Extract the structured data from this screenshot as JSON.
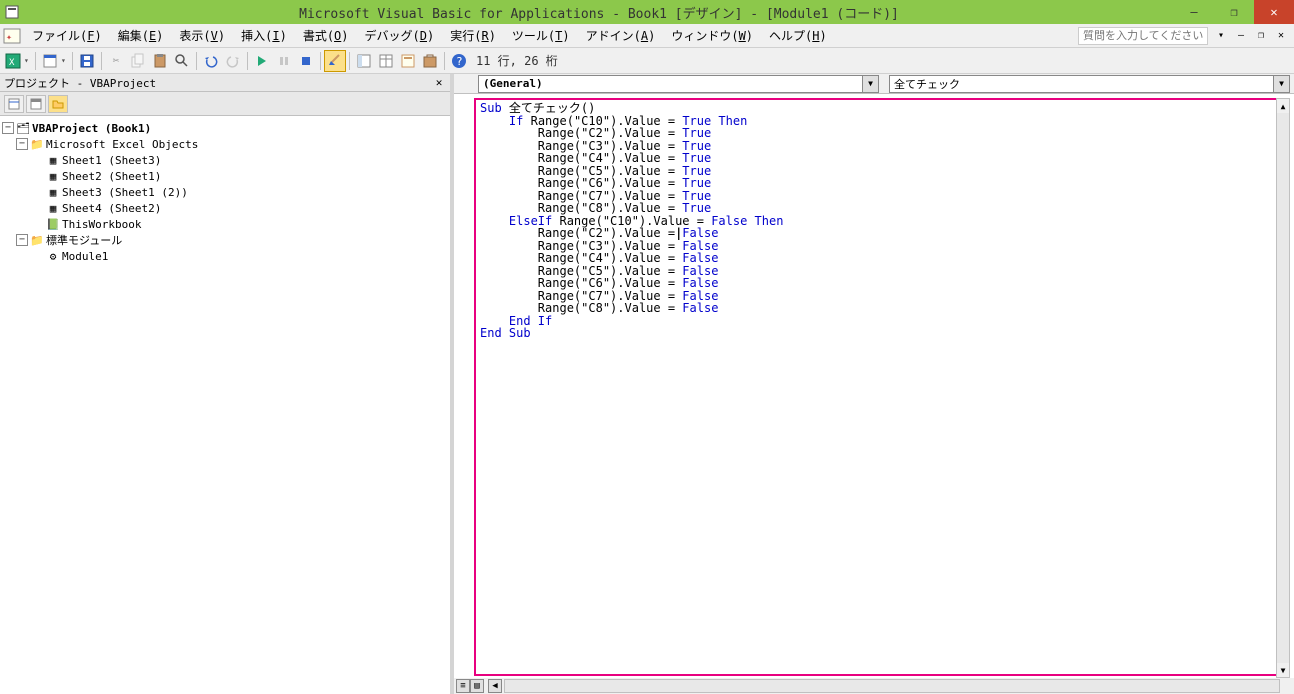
{
  "title": "Microsoft Visual Basic for Applications - Book1 [デザイン] - [Module1 (コード)]",
  "menus": {
    "file": {
      "label": "ファイル(",
      "key": "F",
      "suffix": ")"
    },
    "edit": {
      "label": "編集(",
      "key": "E",
      "suffix": ")"
    },
    "view": {
      "label": "表示(",
      "key": "V",
      "suffix": ")"
    },
    "insert": {
      "label": "挿入(",
      "key": "I",
      "suffix": ")"
    },
    "format": {
      "label": "書式(",
      "key": "O",
      "suffix": ")"
    },
    "debug": {
      "label": "デバッグ(",
      "key": "D",
      "suffix": ")"
    },
    "run": {
      "label": "実行(",
      "key": "R",
      "suffix": ")"
    },
    "tools": {
      "label": "ツール(",
      "key": "T",
      "suffix": ")"
    },
    "addin": {
      "label": "アドイン(",
      "key": "A",
      "suffix": ")"
    },
    "window": {
      "label": "ウィンドウ(",
      "key": "W",
      "suffix": ")"
    },
    "help": {
      "label": "ヘルプ(",
      "key": "H",
      "suffix": ")"
    }
  },
  "help_placeholder": "質問を入力してください",
  "toolbar": {
    "cursor_info": "11 行, 26 桁"
  },
  "project_panel": {
    "title": "プロジェクト - VBAProject",
    "root": "VBAProject (Book1)",
    "objects_folder": "Microsoft Excel Objects",
    "modules_folder": "標準モジュール",
    "sheets": [
      "Sheet1 (Sheet3)",
      "Sheet2 (Sheet1)",
      "Sheet3 (Sheet1 (2))",
      "Sheet4 (Sheet2)"
    ],
    "thisworkbook": "ThisWorkbook",
    "module": "Module1"
  },
  "code_dropdowns": {
    "object": "(General)",
    "procedure": "全てチェック"
  },
  "code_lines": [
    {
      "indent": 0,
      "tokens": [
        {
          "t": "Sub ",
          "k": true
        },
        {
          "t": "全てチェック()"
        }
      ]
    },
    {
      "indent": 1,
      "tokens": [
        {
          "t": "If ",
          "k": true
        },
        {
          "t": "Range(\"C10\").Value = "
        },
        {
          "t": "True Then",
          "k": true
        }
      ]
    },
    {
      "indent": 2,
      "tokens": [
        {
          "t": "Range(\"C2\").Value = "
        },
        {
          "t": "True",
          "k": true
        }
      ]
    },
    {
      "indent": 2,
      "tokens": [
        {
          "t": "Range(\"C3\").Value = "
        },
        {
          "t": "True",
          "k": true
        }
      ]
    },
    {
      "indent": 2,
      "tokens": [
        {
          "t": "Range(\"C4\").Value = "
        },
        {
          "t": "True",
          "k": true
        }
      ]
    },
    {
      "indent": 2,
      "tokens": [
        {
          "t": "Range(\"C5\").Value = "
        },
        {
          "t": "True",
          "k": true
        }
      ]
    },
    {
      "indent": 2,
      "tokens": [
        {
          "t": "Range(\"C6\").Value = "
        },
        {
          "t": "True",
          "k": true
        }
      ]
    },
    {
      "indent": 2,
      "tokens": [
        {
          "t": "Range(\"C7\").Value = "
        },
        {
          "t": "True",
          "k": true
        }
      ]
    },
    {
      "indent": 2,
      "tokens": [
        {
          "t": "Range(\"C8\").Value = "
        },
        {
          "t": "True",
          "k": true
        }
      ]
    },
    {
      "indent": 1,
      "tokens": [
        {
          "t": "ElseIf ",
          "k": true
        },
        {
          "t": "Range(\"C10\").Value = "
        },
        {
          "t": "False Then",
          "k": true
        }
      ]
    },
    {
      "indent": 2,
      "tokens": [
        {
          "t": "Range(\"C2\").Value ="
        },
        {
          "t": "|",
          "cursor": true
        },
        {
          "t": " False",
          "k": true
        }
      ]
    },
    {
      "indent": 2,
      "tokens": [
        {
          "t": "Range(\"C3\").Value = "
        },
        {
          "t": "False",
          "k": true
        }
      ]
    },
    {
      "indent": 2,
      "tokens": [
        {
          "t": "Range(\"C4\").Value = "
        },
        {
          "t": "False",
          "k": true
        }
      ]
    },
    {
      "indent": 2,
      "tokens": [
        {
          "t": "Range(\"C5\").Value = "
        },
        {
          "t": "False",
          "k": true
        }
      ]
    },
    {
      "indent": 2,
      "tokens": [
        {
          "t": "Range(\"C6\").Value = "
        },
        {
          "t": "False",
          "k": true
        }
      ]
    },
    {
      "indent": 2,
      "tokens": [
        {
          "t": "Range(\"C7\").Value = "
        },
        {
          "t": "False",
          "k": true
        }
      ]
    },
    {
      "indent": 2,
      "tokens": [
        {
          "t": "Range(\"C8\").Value = "
        },
        {
          "t": "False",
          "k": true
        }
      ]
    },
    {
      "indent": 1,
      "tokens": [
        {
          "t": "End If",
          "k": true
        }
      ]
    },
    {
      "indent": 0,
      "tokens": [
        {
          "t": "End Sub",
          "k": true
        }
      ]
    }
  ]
}
